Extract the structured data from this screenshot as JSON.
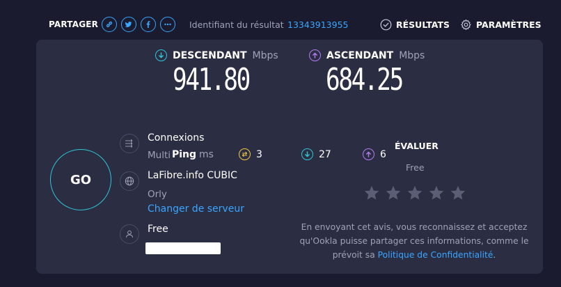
{
  "share": {
    "label": "PARTAGER",
    "buttons": [
      "link-icon",
      "twitter-icon",
      "facebook-icon",
      "more-icon"
    ]
  },
  "result": {
    "label": "Identifiant du résultat",
    "id": "13343913955"
  },
  "nav": {
    "results": "RÉSULTATS",
    "settings": "PARAMÈTRES"
  },
  "download": {
    "label": "DESCENDANT",
    "unit": "Mbps",
    "value": "941.80",
    "color": "#2ec7d4"
  },
  "upload": {
    "label": "ASCENDANT",
    "unit": "Mbps",
    "value": "684.25",
    "color": "#b47cf0"
  },
  "ping": {
    "label": "Ping",
    "unit": "ms",
    "idle": "3",
    "download": "27",
    "upload": "6",
    "idle_color": "#f5c842"
  },
  "go": {
    "label": "GO"
  },
  "connections": {
    "title": "Connexions",
    "value": "Multi"
  },
  "server": {
    "title": "LaFibre.info CUBIC",
    "location": "Orly",
    "change_link": "Changer de serveur"
  },
  "provider": {
    "title": "Free"
  },
  "rating": {
    "title": "ÉVALUER",
    "provider": "Free",
    "stars": 5,
    "consent_text": "En envoyant cet avis, vous reconnaissez et acceptez qu'Ookla puisse partager ces informations, comme le prévoit sa",
    "privacy_link": "Politique de Confidentialité",
    "consent_end": "."
  }
}
